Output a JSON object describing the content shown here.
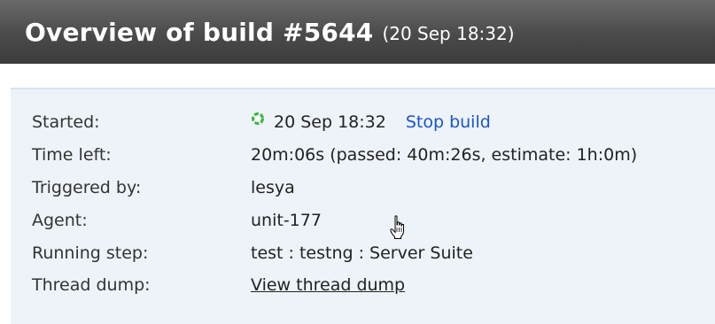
{
  "header": {
    "title": "Overview of build #5644",
    "date": "(20 Sep 18:32)"
  },
  "details": {
    "started": {
      "label": "Started:",
      "value": "20 Sep 18:32",
      "action": "Stop build",
      "icon": "running-spinner-icon"
    },
    "time_left": {
      "label": "Time left:",
      "value": "20m:06s (passed: 40m:26s, estimate: 1h:0m)"
    },
    "triggered_by": {
      "label": "Triggered by:",
      "value": "lesya"
    },
    "agent": {
      "label": "Agent:",
      "value": "unit-177"
    },
    "running_step": {
      "label": "Running step:",
      "value": "test : testng : Server Suite"
    },
    "thread_dump": {
      "label": "Thread dump:",
      "value": "View thread dump"
    }
  },
  "colors": {
    "header_top": "#6a6a6a",
    "header_bottom": "#3c3c3c",
    "panel_bg": "#edf3f9",
    "link": "#1a56c7",
    "spinner": "#3cb43c"
  }
}
